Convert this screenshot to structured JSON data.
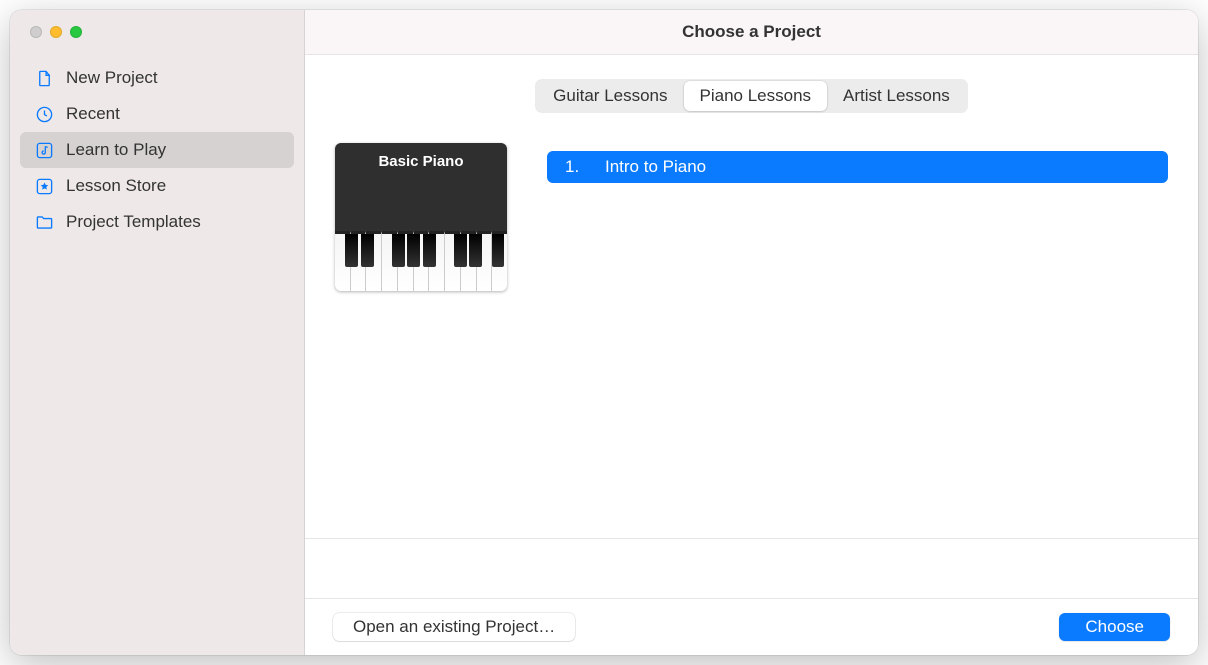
{
  "window": {
    "title": "Choose a Project"
  },
  "sidebar": {
    "items": [
      {
        "label": "New Project",
        "icon": "document-icon"
      },
      {
        "label": "Recent",
        "icon": "clock-icon"
      },
      {
        "label": "Learn to Play",
        "icon": "music-note-square-icon",
        "selected": true
      },
      {
        "label": "Lesson Store",
        "icon": "star-square-icon"
      },
      {
        "label": "Project Templates",
        "icon": "folder-icon"
      }
    ]
  },
  "tabs": {
    "items": [
      {
        "label": "Guitar Lessons"
      },
      {
        "label": "Piano Lessons",
        "active": true
      },
      {
        "label": "Artist Lessons"
      }
    ]
  },
  "thumbnail": {
    "title": "Basic Piano"
  },
  "lessons": {
    "items": [
      {
        "num": "1.",
        "title": "Intro to Piano",
        "selected": true
      }
    ]
  },
  "footer": {
    "open_label": "Open an existing Project…",
    "choose_label": "Choose"
  }
}
